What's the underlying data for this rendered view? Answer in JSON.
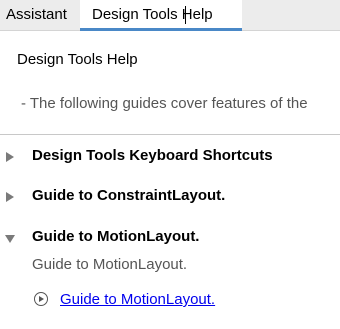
{
  "tabs": {
    "assistant": "Assistant",
    "design_tools_help": "Design Tools Help"
  },
  "page": {
    "title": "Design Tools Help",
    "description": "- The following guides cover features of the"
  },
  "sections": [
    {
      "title": "Design Tools Keyboard Shortcuts",
      "expanded": false,
      "icon": "chevron-right-icon"
    },
    {
      "title": "Guide to ConstraintLayout.",
      "expanded": false,
      "icon": "chevron-right-icon"
    },
    {
      "title": "Guide to MotionLayout.",
      "expanded": true,
      "icon": "chevron-down-icon",
      "subtitle": "Guide to MotionLayout.",
      "link": {
        "label": "Guide to MotionLayout.",
        "icon": "play-circle-icon"
      }
    }
  ],
  "colors": {
    "tabbar_bg": "#ececec",
    "active_tab_underline": "#4a88c7",
    "link": "#0000ee",
    "muted_text": "#555555",
    "chevron": "#7a7a7a"
  }
}
